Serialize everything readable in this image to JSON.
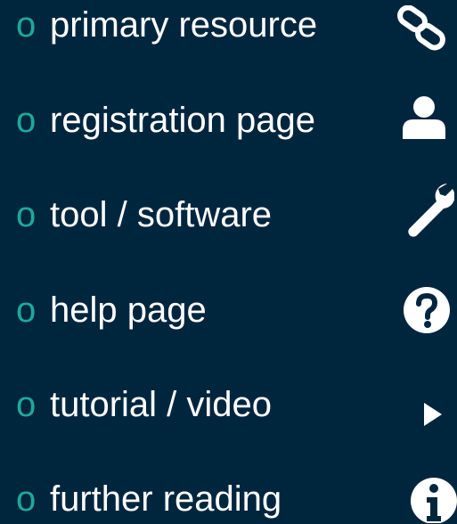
{
  "colors": {
    "background": "#00263e",
    "bullet": "#1fa89a",
    "text": "#ffffff",
    "icon": "#ffffff"
  },
  "legend": {
    "items": [
      {
        "bullet": "o",
        "label": "primary resource",
        "icon": "link-icon"
      },
      {
        "bullet": "o",
        "label": "registration page",
        "icon": "user-icon"
      },
      {
        "bullet": "o",
        "label": "tool / software",
        "icon": "wrench-icon"
      },
      {
        "bullet": "o",
        "label": "help page",
        "icon": "question-circle-icon"
      },
      {
        "bullet": "o",
        "label": "tutorial / video",
        "icon": "play-icon"
      },
      {
        "bullet": "o",
        "label": "further reading",
        "icon": "info-circle-icon"
      }
    ]
  }
}
